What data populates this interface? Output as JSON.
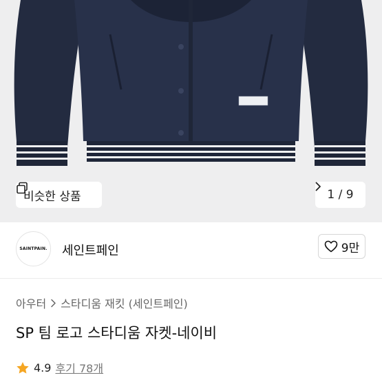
{
  "similar_products_label": "비슷한 상품",
  "pager": {
    "text": "1 / 9",
    "chevron": "chevron-right-icon"
  },
  "brand": {
    "logo_text": "SAINTPAIN.",
    "name": "세인트페인"
  },
  "like": {
    "count": "9만",
    "icon": "heart-outline-icon"
  },
  "breadcrumb": {
    "first": "아우터",
    "second": "스타디움 재킷 (세인트페인)"
  },
  "product": {
    "title": "SP 팀 로고 스타디움 자켓-네이비"
  },
  "rating": {
    "score": "4.9",
    "reviews": "후기 78개",
    "star_color": "#f5a623"
  },
  "image": {
    "garment_color": "#252e45",
    "background_color": "#eeeeef"
  }
}
